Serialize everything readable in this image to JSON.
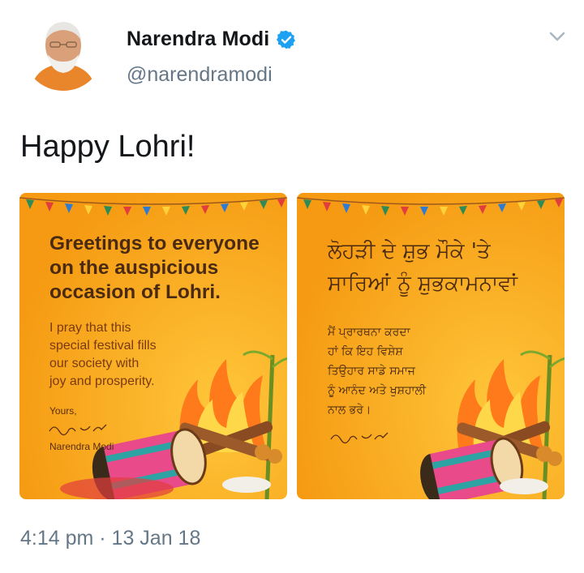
{
  "author": {
    "name": "Narendra Modi",
    "handle": "@narendramodi",
    "verified": true
  },
  "tweet": {
    "text": "Happy Lohri!",
    "timestamp": "4:14 pm · 13 Jan 18"
  },
  "media": [
    {
      "heading": "Greetings to everyone\non the auspicious\noccasion of Lohri.",
      "body": "I pray that this\nspecial festival fills\nour society with\njoy and prosperity.",
      "signoff": "Yours,",
      "signature_name": "Narendra Modi"
    },
    {
      "heading": "ਲੋਹੜੀ ਦੇ ਸ਼ੁਭ ਮੌਕੇ 'ਤੇ\nਸਾਰਿਆਂ ਨੂੰ ਸ਼ੁਭਕਾਮਨਾਵਾਂ",
      "body": "ਮੈਂ ਪ੍ਰਾਰਥਨਾ ਕਰਦਾ\nਹਾਂ ਕਿ ਇਹ ਵਿਸ਼ੇਸ਼\nਤਿਉਹਾਰ ਸਾਡੇ ਸਮਾਜ\nਨੂੰ ਆਨੰਦ ਅਤੇ ਖੁਸ਼ਹਾਲੀ\nਨਾਲ ਭਰੇ।"
    }
  ],
  "colors": {
    "card_orange": "#f7a21b",
    "verified_blue": "#1da1f2",
    "muted_text": "#657786"
  },
  "icons": [
    "verified-badge-icon",
    "chevron-down-icon"
  ]
}
